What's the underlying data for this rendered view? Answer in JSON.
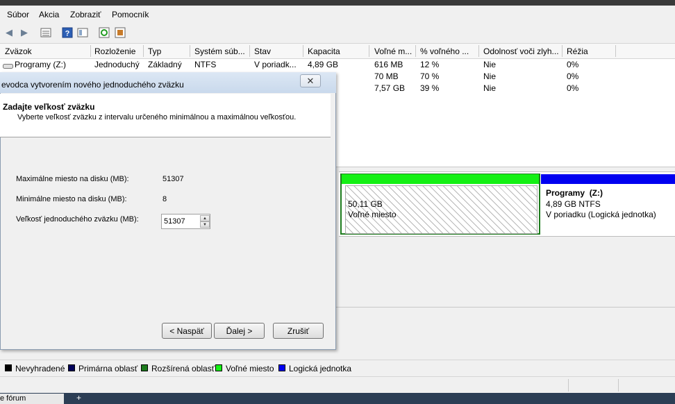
{
  "menu": {
    "items": [
      "Súbor",
      "Akcia",
      "Zobraziť",
      "Pomocník"
    ]
  },
  "toolbar": {
    "icons": [
      "back-arrow-icon",
      "forward-arrow-icon",
      "list-view-icon",
      "help-icon",
      "properties-icon",
      "refresh-icon",
      "settings-icon"
    ]
  },
  "volumes": {
    "headers": [
      "Zväzok",
      "Rozloženie",
      "Typ",
      "Systém súb...",
      "Stav",
      "Kapacita",
      "Voľné m...",
      "% voľného ...",
      "Odolnosť voči zlyh...",
      "Réžia"
    ],
    "rows": [
      {
        "name": "Programy (Z:)",
        "layout": "Jednoduchý",
        "type": "Základný",
        "fs": "NTFS",
        "status": "V poriadk...",
        "capacity": "4,89 GB",
        "free": "616 MB",
        "pct": "12 %",
        "fault": "Nie",
        "overhead": "0%"
      },
      {
        "name": "",
        "layout": "",
        "type": "",
        "fs": "",
        "status": "",
        "capacity": "",
        "free": "70 MB",
        "pct": "70 %",
        "fault": "Nie",
        "overhead": "0%"
      },
      {
        "name": "",
        "layout": "",
        "type": "",
        "fs": "",
        "status": "",
        "capacity": "",
        "free": "7,57 GB",
        "pct": "39 %",
        "fault": "Nie",
        "overhead": "0%"
      }
    ]
  },
  "disk": {
    "free_size": "50,11 GB",
    "free_label": "Voľné miesto",
    "logical_name": "Programy  (Z:)",
    "logical_size": "4,89 GB NTFS",
    "logical_status": "V poriadku (Logická jednotka)"
  },
  "legend": [
    {
      "label": "Nevyhradené",
      "color": "#000000"
    },
    {
      "label": "Primárna oblasť",
      "color": "#00005a"
    },
    {
      "label": "Rozšírená oblasť",
      "color": "#1e7c1e"
    },
    {
      "label": "Voľné miesto",
      "color": "#14f014"
    },
    {
      "label": "Logická jednotka",
      "color": "#0000f0"
    }
  ],
  "wizard": {
    "title": "evodca vytvorením nového jednoduchého zväzku",
    "heading": "Zadajte veľkosť zväzku",
    "subheading": "Vyberte veľkosť zväzku z intervalu určeného minimálnou a maximálnou veľkosťou.",
    "max_label": "Maximálne miesto na disku (MB):",
    "max_value": "51307",
    "min_label": "Minimálne miesto na disku (MB):",
    "min_value": "8",
    "size_label": "Veľkosť jednoduchého zväzku (MB):",
    "size_value": "51307",
    "back_button": "< Naspäť",
    "next_button": "Ďalej >",
    "cancel_button": "Zrušiť"
  },
  "taskbar": {
    "text": "e fórum"
  }
}
